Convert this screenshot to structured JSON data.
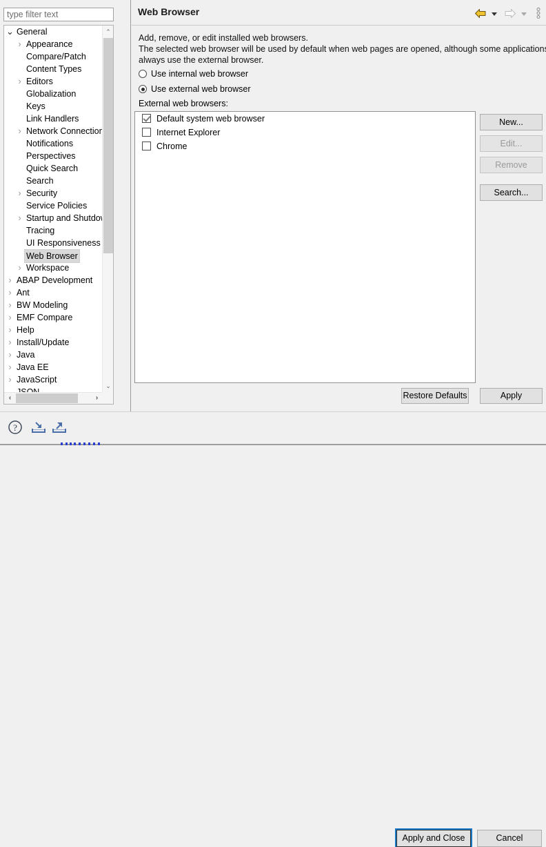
{
  "filter": {
    "placeholder": "type filter text",
    "value": ""
  },
  "tree": {
    "items": [
      {
        "label": "General",
        "level": 0,
        "twisty": "expanded",
        "selected": false
      },
      {
        "label": "Appearance",
        "level": 1,
        "twisty": "collapsed",
        "selected": false
      },
      {
        "label": "Compare/Patch",
        "level": 1,
        "twisty": "none",
        "selected": false
      },
      {
        "label": "Content Types",
        "level": 1,
        "twisty": "none",
        "selected": false
      },
      {
        "label": "Editors",
        "level": 1,
        "twisty": "collapsed",
        "selected": false
      },
      {
        "label": "Globalization",
        "level": 1,
        "twisty": "none",
        "selected": false
      },
      {
        "label": "Keys",
        "level": 1,
        "twisty": "none",
        "selected": false
      },
      {
        "label": "Link Handlers",
        "level": 1,
        "twisty": "none",
        "selected": false
      },
      {
        "label": "Network Connections",
        "level": 1,
        "twisty": "collapsed",
        "selected": false
      },
      {
        "label": "Notifications",
        "level": 1,
        "twisty": "none",
        "selected": false
      },
      {
        "label": "Perspectives",
        "level": 1,
        "twisty": "none",
        "selected": false
      },
      {
        "label": "Quick Search",
        "level": 1,
        "twisty": "none",
        "selected": false
      },
      {
        "label": "Search",
        "level": 1,
        "twisty": "none",
        "selected": false
      },
      {
        "label": "Security",
        "level": 1,
        "twisty": "collapsed",
        "selected": false
      },
      {
        "label": "Service Policies",
        "level": 1,
        "twisty": "none",
        "selected": false
      },
      {
        "label": "Startup and Shutdown",
        "level": 1,
        "twisty": "collapsed",
        "selected": false
      },
      {
        "label": "Tracing",
        "level": 1,
        "twisty": "none",
        "selected": false
      },
      {
        "label": "UI Responsiveness Monitoring",
        "level": 1,
        "twisty": "none",
        "selected": false
      },
      {
        "label": "Web Browser",
        "level": 1,
        "twisty": "none",
        "selected": true
      },
      {
        "label": "Workspace",
        "level": 1,
        "twisty": "collapsed",
        "selected": false
      },
      {
        "label": "ABAP Development",
        "level": 0,
        "twisty": "collapsed",
        "selected": false
      },
      {
        "label": "Ant",
        "level": 0,
        "twisty": "collapsed",
        "selected": false
      },
      {
        "label": "BW Modeling",
        "level": 0,
        "twisty": "collapsed",
        "selected": false
      },
      {
        "label": "EMF Compare",
        "level": 0,
        "twisty": "collapsed",
        "selected": false
      },
      {
        "label": "Help",
        "level": 0,
        "twisty": "collapsed",
        "selected": false
      },
      {
        "label": "Install/Update",
        "level": 0,
        "twisty": "collapsed",
        "selected": false
      },
      {
        "label": "Java",
        "level": 0,
        "twisty": "collapsed",
        "selected": false
      },
      {
        "label": "Java EE",
        "level": 0,
        "twisty": "collapsed",
        "selected": false
      },
      {
        "label": "JavaScript",
        "level": 0,
        "twisty": "collapsed",
        "selected": false
      },
      {
        "label": "JSON",
        "level": 0,
        "twisty": "expanded",
        "selected": false
      }
    ],
    "scroll_up_glyph": "⌃",
    "scroll_down_glyph": "⌄",
    "scroll_left_glyph": "‹",
    "scroll_right_glyph": "›"
  },
  "page": {
    "title": "Web Browser",
    "description_line1": "Add, remove, or edit installed web browsers.",
    "description_line2": "The selected web browser will be used by default when web pages are opened, although some applications may",
    "description_line3": "always use the external browser.",
    "radios": [
      {
        "label": "Use internal web browser",
        "selected": false
      },
      {
        "label": "Use external web browser",
        "selected": true
      }
    ],
    "browsers_label": "External web browsers:",
    "browsers": [
      {
        "label": "Default system web browser",
        "checked": true
      },
      {
        "label": "Internet Explorer",
        "checked": false
      },
      {
        "label": "Chrome",
        "checked": false
      }
    ],
    "side_buttons": [
      {
        "label": "New...",
        "enabled": true
      },
      {
        "label": "Edit...",
        "enabled": false
      },
      {
        "label": "Remove",
        "enabled": false
      },
      {
        "label": "Search...",
        "enabled": true
      }
    ],
    "restore_defaults_label": "Restore Defaults",
    "apply_label": "Apply"
  },
  "footer": {
    "apply_and_close_label": "Apply and Close",
    "cancel_label": "Cancel"
  },
  "colors": {
    "back_arrow": "#f0c330",
    "forward_arrow_disabled": "#c6c6c6",
    "focus_ring": "#1878c8",
    "selection": "#d9d9d9",
    "icon_blue": "#4a6fa8"
  }
}
